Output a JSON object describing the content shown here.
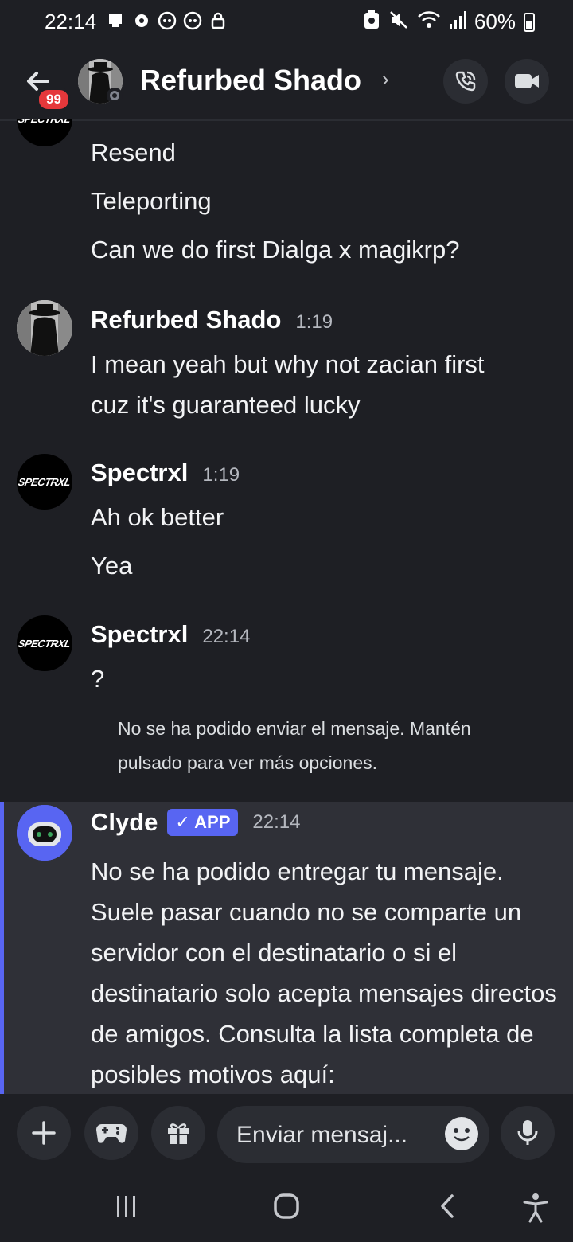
{
  "status_bar": {
    "time": "22:14",
    "battery": "60%",
    "battery_level": 0.6,
    "left_icons": [
      "notification-icon",
      "vpn-icon",
      "discord-icon",
      "discord-icon",
      "lock-icon"
    ],
    "right_icons": [
      "battery-saver-icon",
      "mute-icon",
      "wifi-icon",
      "signal-icon"
    ]
  },
  "header": {
    "title": "Refurbed Shado",
    "badge_count": "99",
    "chevron": "›"
  },
  "messages": {
    "prev_lines": [
      "Resend",
      "Teleporting",
      "Can we do first Dialga x magikrp?"
    ],
    "groups": [
      {
        "username": "Refurbed Shado",
        "time": "1:19",
        "lines": [
          "I mean yeah but why not zacian first",
          "cuz it's guaranteed lucky"
        ]
      },
      {
        "username": "Spectrxl",
        "time": "1:19",
        "lines": [
          "Ah ok better",
          "Yea"
        ]
      },
      {
        "username": "Spectrxl",
        "time": "22:14",
        "lines": [
          "?"
        ]
      }
    ],
    "error": "No se ha podido enviar el mensaje. Mantén pulsado para ver más opciones.",
    "avatar_text": "SPECTRXL"
  },
  "clyde": {
    "username": "Clyde",
    "badge": "APP",
    "badge_check": "✓",
    "time": "22:14",
    "text": "No se ha podido entregar tu mensaje. Suele pasar cuando no se comparte un servidor con el destinatario o si el destinatario solo acepta mensajes directos de amigos. Consulta la lista completa de posibles motivos aquí:"
  },
  "composer": {
    "placeholder": "Enviar mensaj..."
  },
  "colors": {
    "background": "#1e1f24",
    "accent": "#5865f2",
    "badge": "#e5383b"
  }
}
